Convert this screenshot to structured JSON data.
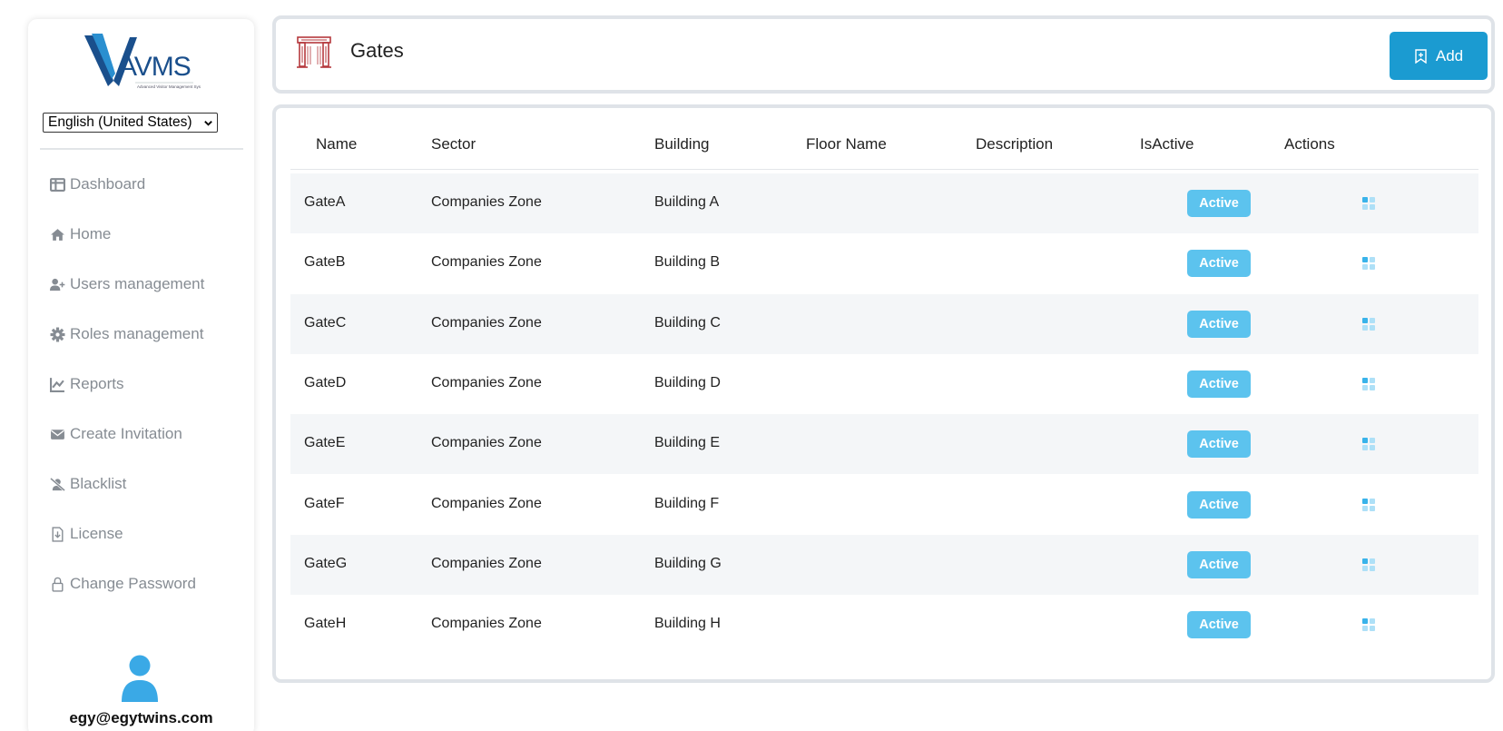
{
  "brand": {
    "logo_text": "AVMS",
    "logo_subtitle": "Advanced Visitor Management System"
  },
  "language": {
    "selected": "English (United States)"
  },
  "sidebar": {
    "items": [
      {
        "label": "Dashboard",
        "icon": "dashboard-icon"
      },
      {
        "label": "Home",
        "icon": "home-icon"
      },
      {
        "label": "Users management",
        "icon": "user-plus-icon"
      },
      {
        "label": "Roles management",
        "icon": "gear-icon"
      },
      {
        "label": "Reports",
        "icon": "chart-line-icon"
      },
      {
        "label": "Create Invitation",
        "icon": "envelope-icon"
      },
      {
        "label": "Blacklist",
        "icon": "user-slash-icon"
      },
      {
        "label": "License",
        "icon": "file-download-icon"
      },
      {
        "label": "Change Password",
        "icon": "lock-icon"
      }
    ]
  },
  "user": {
    "email": "egy@egytwins.com"
  },
  "header": {
    "title": "Gates",
    "add_label": "Add"
  },
  "table": {
    "columns": [
      "Name",
      "Sector",
      "Building",
      "Floor Name",
      "Description",
      "IsActive",
      "Actions"
    ],
    "rows": [
      {
        "name": "GateA",
        "sector": "Companies Zone",
        "building": "Building A",
        "floor": "",
        "description": "",
        "status": "Active"
      },
      {
        "name": "GateB",
        "sector": "Companies Zone",
        "building": "Building B",
        "floor": "",
        "description": "",
        "status": "Active"
      },
      {
        "name": "GateC",
        "sector": "Companies Zone",
        "building": "Building C",
        "floor": "",
        "description": "",
        "status": "Active"
      },
      {
        "name": "GateD",
        "sector": "Companies Zone",
        "building": "Building D",
        "floor": "",
        "description": "",
        "status": "Active"
      },
      {
        "name": "GateE",
        "sector": "Companies Zone",
        "building": "Building E",
        "floor": "",
        "description": "",
        "status": "Active"
      },
      {
        "name": "GateF",
        "sector": "Companies Zone",
        "building": "Building F",
        "floor": "",
        "description": "",
        "status": "Active"
      },
      {
        "name": "GateG",
        "sector": "Companies Zone",
        "building": "Building G",
        "floor": "",
        "description": "",
        "status": "Active"
      },
      {
        "name": "GateH",
        "sector": "Companies Zone",
        "building": "Building H",
        "floor": "",
        "description": "",
        "status": "Active"
      }
    ]
  },
  "colors": {
    "accent": "#1b9bd1",
    "badge": "#5cc3ee",
    "sidebar_text": "#868c93",
    "stripe": "#f4f6f8",
    "gate_icon": "#b5393d"
  }
}
